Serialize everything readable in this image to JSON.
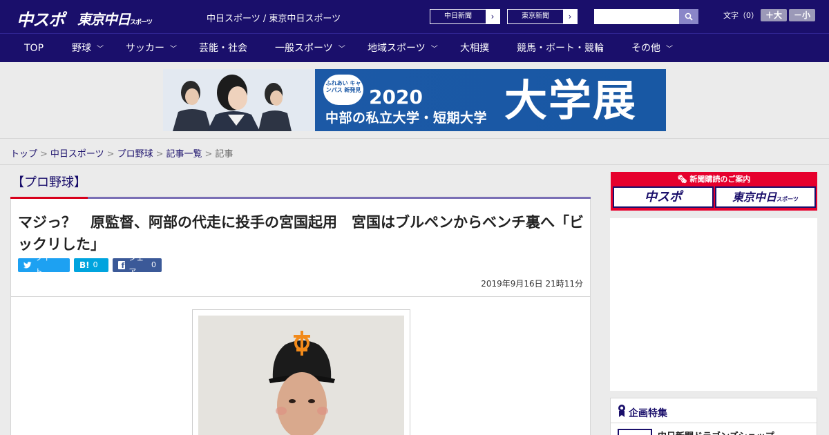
{
  "header": {
    "logo_chuspo": "中スポ",
    "logo_tokyo": "東京中日",
    "logo_tokyo_small": "スポーツ",
    "site_name": "中日スポーツ / 東京中日スポーツ",
    "paper_links": [
      "中日新聞",
      "東京新聞"
    ],
    "search_placeholder": "",
    "font_label": "文字（0）",
    "font_larger": "＋大",
    "font_smaller": "－小"
  },
  "nav": {
    "items": [
      {
        "label": "TOP"
      },
      {
        "label": "野球"
      },
      {
        "label": "サッカー"
      },
      {
        "label": "芸能・社会"
      },
      {
        "label": "一般スポーツ"
      },
      {
        "label": "地域スポーツ"
      },
      {
        "label": "大相撲"
      },
      {
        "label": "競馬・ボート・競輪"
      },
      {
        "label": "その他"
      }
    ]
  },
  "banner": {
    "badge": "ふれあい キャンパス 新発見",
    "year": "2020",
    "subtitle": "中部の私立大学・短期大学",
    "headline": "大学展"
  },
  "breadcrumb": {
    "items": [
      "トップ",
      "中日スポーツ",
      "プロ野球",
      "記事一覧"
    ],
    "current": "記事",
    "separator": ">"
  },
  "article": {
    "category": "【プロ野球】",
    "title": "マジっ？　原監督、阿部の代走に投手の宮国起用　宮国はブルペンからベンチ裏へ「ビックリした」",
    "share": {
      "twitter": "ツイート",
      "hatena_label": "B!",
      "hatena_count": "0",
      "facebook": "シェア",
      "facebook_count": "0"
    },
    "date": "2019年9月16日 21時11分"
  },
  "sidebar": {
    "promo_title": "新聞購読のご案内",
    "promo_links": [
      "中スポ",
      "東京中日"
    ],
    "promo_links_small": [
      "",
      "スポーツ"
    ],
    "feature_title": "企画特集",
    "feature_item": "中日新聞ドラゴンズショップ"
  },
  "colors": {
    "brand_navy": "#1a0f6b",
    "accent_red": "#d8001c",
    "twitter": "#1da1f2",
    "hatena": "#00a4de",
    "facebook": "#3b5998"
  }
}
